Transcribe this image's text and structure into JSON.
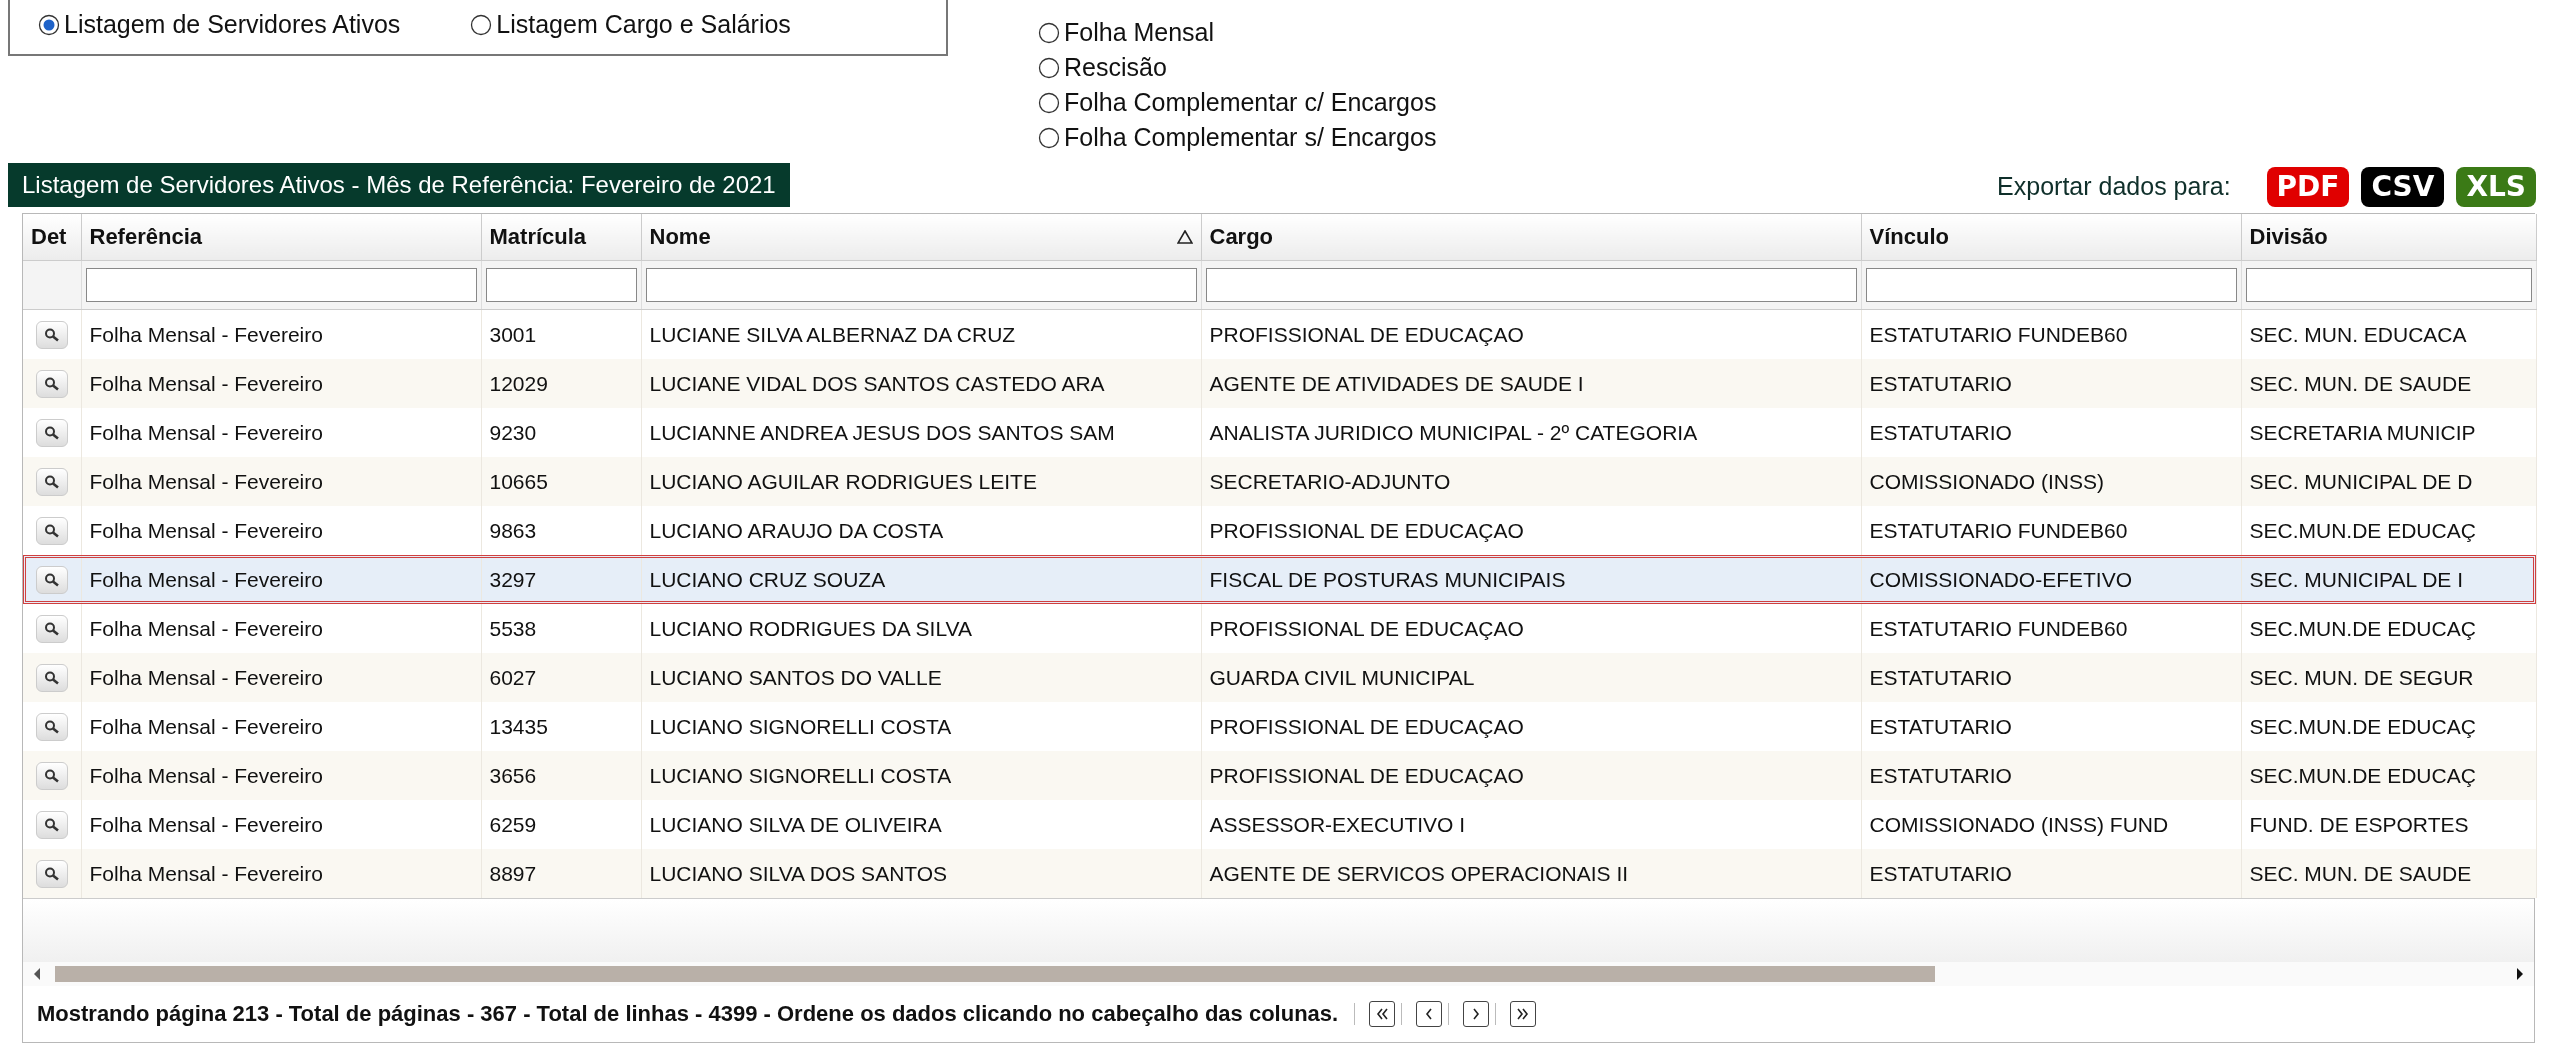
{
  "report_type": {
    "options": [
      {
        "label": "Listagem de Servidores Ativos",
        "selected": true
      },
      {
        "label": "Listagem Cargo e Salários",
        "selected": false
      }
    ]
  },
  "payroll_type": {
    "options": [
      {
        "label": "Folha Mensal",
        "selected": false
      },
      {
        "label": "Rescisão",
        "selected": false
      },
      {
        "label": "Folha Complementar c/ Encargos",
        "selected": false
      },
      {
        "label": "Folha Complementar s/ Encargos",
        "selected": false
      }
    ]
  },
  "grid_title": "Listagem de Servidores Ativos - Mês de Referência: Fevereiro de 2021",
  "export": {
    "label": "Exportar dados para:",
    "formats": [
      {
        "label": "PDF",
        "color": "#e00000"
      },
      {
        "label": "CSV",
        "color": "#000000"
      },
      {
        "label": "XLS",
        "color": "#3b7a16"
      }
    ]
  },
  "table": {
    "columns": [
      {
        "label": "Det",
        "sorted": false,
        "filterable": false
      },
      {
        "label": "Referência",
        "sorted": false,
        "filterable": true
      },
      {
        "label": "Matrícula",
        "sorted": false,
        "filterable": true
      },
      {
        "label": "Nome",
        "sorted": true,
        "filterable": true
      },
      {
        "label": "Cargo",
        "sorted": false,
        "filterable": true
      },
      {
        "label": "Vínculo",
        "sorted": false,
        "filterable": true
      },
      {
        "label": "Divisão",
        "sorted": false,
        "filterable": true
      }
    ],
    "rows": [
      {
        "selected": false,
        "cells": [
          "",
          "Folha Mensal - Fevereiro",
          "3001",
          "LUCIANE SILVA ALBERNAZ DA CRUZ",
          "PROFISSIONAL DE EDUCAÇAO",
          "ESTATUTARIO FUNDEB60",
          "SEC. MUN. EDUCACA"
        ]
      },
      {
        "selected": false,
        "cells": [
          "",
          "Folha Mensal - Fevereiro",
          "12029",
          "LUCIANE VIDAL DOS SANTOS CASTEDO ARA",
          "AGENTE DE ATIVIDADES DE SAUDE I",
          "ESTATUTARIO",
          "SEC. MUN. DE SAUDE"
        ]
      },
      {
        "selected": false,
        "cells": [
          "",
          "Folha Mensal - Fevereiro",
          "9230",
          "LUCIANNE ANDREA JESUS DOS SANTOS SAM",
          "ANALISTA JURIDICO MUNICIPAL - 2º CATEGORIA",
          "ESTATUTARIO",
          "SECRETARIA MUNICIP"
        ]
      },
      {
        "selected": false,
        "cells": [
          "",
          "Folha Mensal - Fevereiro",
          "10665",
          "LUCIANO AGUILAR RODRIGUES LEITE",
          "SECRETARIO-ADJUNTO",
          "COMISSIONADO (INSS)",
          "SEC. MUNICIPAL DE D"
        ]
      },
      {
        "selected": false,
        "cells": [
          "",
          "Folha Mensal - Fevereiro",
          "9863",
          "LUCIANO ARAUJO DA COSTA",
          "PROFISSIONAL DE EDUCAÇAO",
          "ESTATUTARIO FUNDEB60",
          "SEC.MUN.DE EDUCAÇ"
        ]
      },
      {
        "selected": true,
        "cells": [
          "",
          "Folha Mensal - Fevereiro",
          "3297",
          "LUCIANO CRUZ SOUZA",
          "FISCAL DE POSTURAS MUNICIPAIS",
          "COMISSIONADO-EFETIVO",
          "SEC. MUNICIPAL DE I"
        ]
      },
      {
        "selected": false,
        "cells": [
          "",
          "Folha Mensal - Fevereiro",
          "5538",
          "LUCIANO RODRIGUES DA SILVA",
          "PROFISSIONAL DE EDUCAÇAO",
          "ESTATUTARIO FUNDEB60",
          "SEC.MUN.DE EDUCAÇ"
        ]
      },
      {
        "selected": false,
        "cells": [
          "",
          "Folha Mensal - Fevereiro",
          "6027",
          "LUCIANO SANTOS DO VALLE",
          "GUARDA CIVIL MUNICIPAL",
          "ESTATUTARIO",
          "SEC. MUN. DE SEGUR"
        ]
      },
      {
        "selected": false,
        "cells": [
          "",
          "Folha Mensal - Fevereiro",
          "13435",
          "LUCIANO SIGNORELLI COSTA",
          "PROFISSIONAL DE EDUCAÇAO",
          "ESTATUTARIO",
          "SEC.MUN.DE EDUCAÇ"
        ]
      },
      {
        "selected": false,
        "cells": [
          "",
          "Folha Mensal - Fevereiro",
          "3656",
          "LUCIANO SIGNORELLI COSTA",
          "PROFISSIONAL DE EDUCAÇAO",
          "ESTATUTARIO",
          "SEC.MUN.DE EDUCAÇ"
        ]
      },
      {
        "selected": false,
        "cells": [
          "",
          "Folha Mensal - Fevereiro",
          "6259",
          "LUCIANO SILVA DE OLIVEIRA",
          "ASSESSOR-EXECUTIVO I",
          "COMISSIONADO (INSS) FUND",
          "FUND. DE ESPORTES"
        ]
      },
      {
        "selected": false,
        "cells": [
          "",
          "Folha Mensal - Fevereiro",
          "8897",
          "LUCIANO SILVA DOS SANTOS",
          "AGENTE DE SERVICOS OPERACIONAIS II",
          "ESTATUTARIO",
          "SEC. MUN. DE SAUDE"
        ]
      }
    ]
  },
  "status": "Mostrando página 213 - Total de páginas - 367 - Total de linhas - 4399 - Ordene os dados clicando no cabeçalho das colunas.",
  "pager": [
    {
      "kind": "first"
    },
    {
      "kind": "previous"
    },
    {
      "kind": "next"
    },
    {
      "kind": "last"
    }
  ]
}
